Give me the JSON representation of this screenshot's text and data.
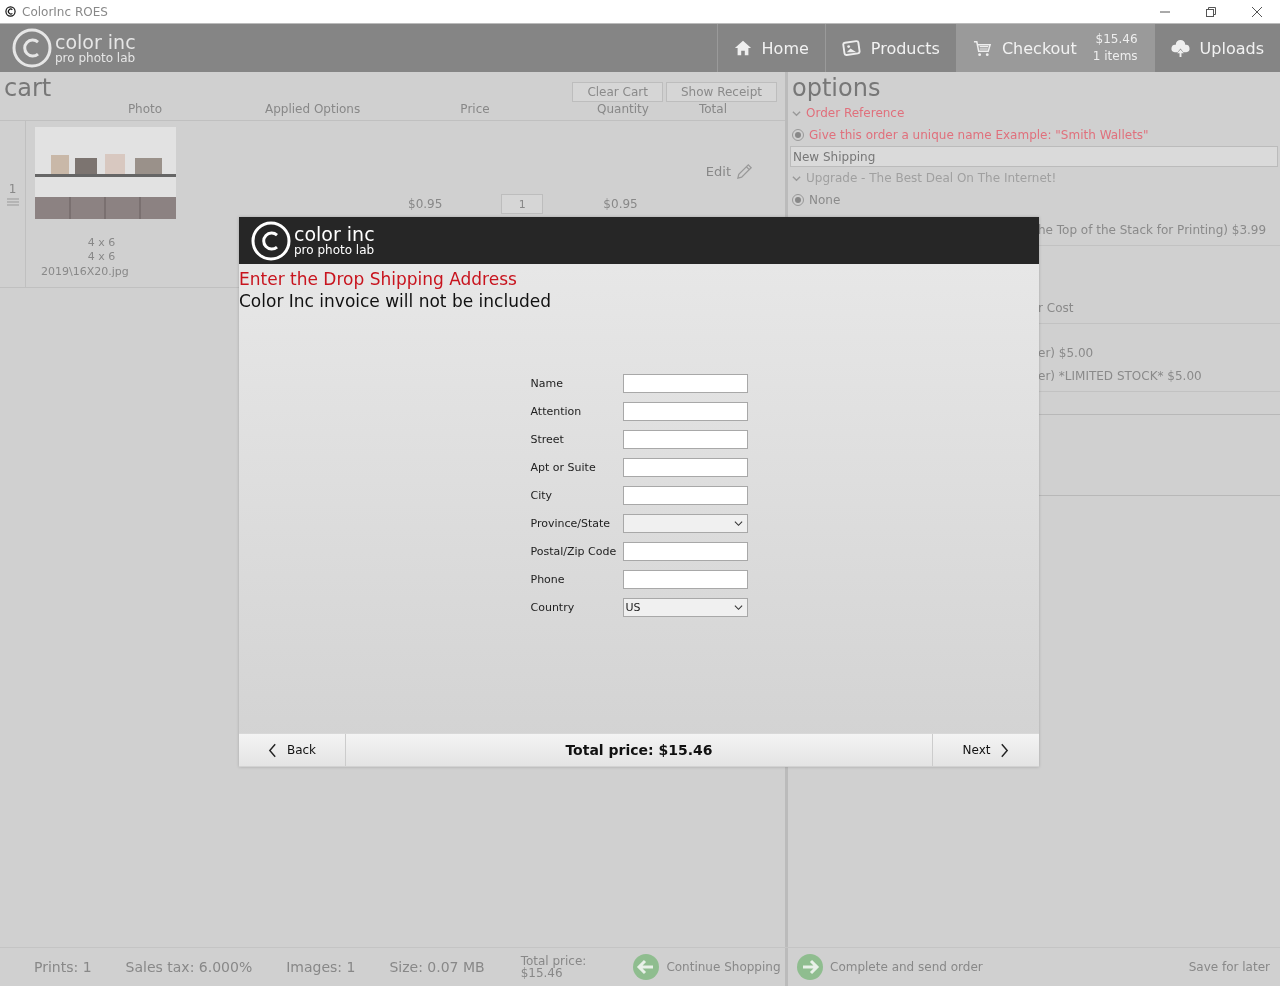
{
  "window": {
    "title": "ColorInc ROES"
  },
  "header": {
    "logo": {
      "name": "color inc",
      "tagline": "pro photo lab"
    },
    "nav": [
      {
        "kind": "home",
        "label": "Home",
        "selected": false
      },
      {
        "kind": "products",
        "label": "Products",
        "selected": false
      },
      {
        "kind": "checkout",
        "label": "Checkout",
        "selected": true,
        "price": "$15.46",
        "count": "1 items"
      },
      {
        "kind": "uploads",
        "label": "Uploads",
        "selected": false
      }
    ]
  },
  "cart": {
    "title": "cart",
    "buttons": [
      "Clear Cart",
      "Show Receipt"
    ],
    "columns": [
      "Photo",
      "Applied Options",
      "Price",
      "Quantity",
      "Total"
    ],
    "rows": [
      {
        "index": "1",
        "size": "4 x 6",
        "size_2": "4 x 6",
        "file": "2019\\16X20.jpg",
        "edit": "Edit",
        "price": "$0.95",
        "quantity": "1",
        "total": "$0.95"
      }
    ]
  },
  "options": {
    "title": "options",
    "rows": [
      {
        "kind": "heading",
        "text": "Order Reference",
        "expanded": true,
        "color": "#e0707c"
      },
      {
        "kind": "radio",
        "text": "Give this order a unique name Example: \"Smith Wallets\"",
        "selected": true,
        "color": "#e0707c"
      },
      {
        "kind": "field",
        "value": "New Shipping"
      },
      {
        "kind": "heading",
        "text": "Upgrade - The Best Deal On The Internet!",
        "expanded": true,
        "color": "#a0a0a0"
      },
      {
        "kind": "radio",
        "text": "None",
        "selected": true,
        "color": "#8a8a8a"
      }
    ],
    "covered_blocks": [
      [
        "he Top of the Stack for Printing) $3.99"
      ],
      [
        "r Cost"
      ],
      [
        "er) $5.00",
        "er) *LIMITED STOCK* $5.00"
      ]
    ]
  },
  "footer": {
    "stats": [
      "Prints: 1",
      "Sales tax: 6.000%",
      "Images: 1",
      "Size: 0.07 MB"
    ],
    "total_label": "Total price:",
    "total_value": "$15.46",
    "continue": "Continue Shopping",
    "complete": "Complete and send order",
    "save": "Save for later"
  },
  "dialog": {
    "logo": {
      "name": "color inc",
      "tagline": "pro photo lab"
    },
    "heading": "Enter the Drop Shipping Address",
    "note": "Color Inc invoice will not be included",
    "fields": [
      {
        "kind": "text",
        "label": "Name"
      },
      {
        "kind": "text",
        "label": "Attention"
      },
      {
        "kind": "text",
        "label": "Street"
      },
      {
        "kind": "text",
        "label": "Apt or Suite"
      },
      {
        "kind": "text",
        "label": "City"
      },
      {
        "kind": "select",
        "label": "Province/State"
      },
      {
        "kind": "text",
        "label": "Postal/Zip Code"
      },
      {
        "kind": "text",
        "label": "Phone"
      },
      {
        "kind": "select",
        "label": "Country",
        "value": "US"
      }
    ],
    "back": "Back",
    "total": "Total price: $15.46",
    "next": "Next"
  }
}
